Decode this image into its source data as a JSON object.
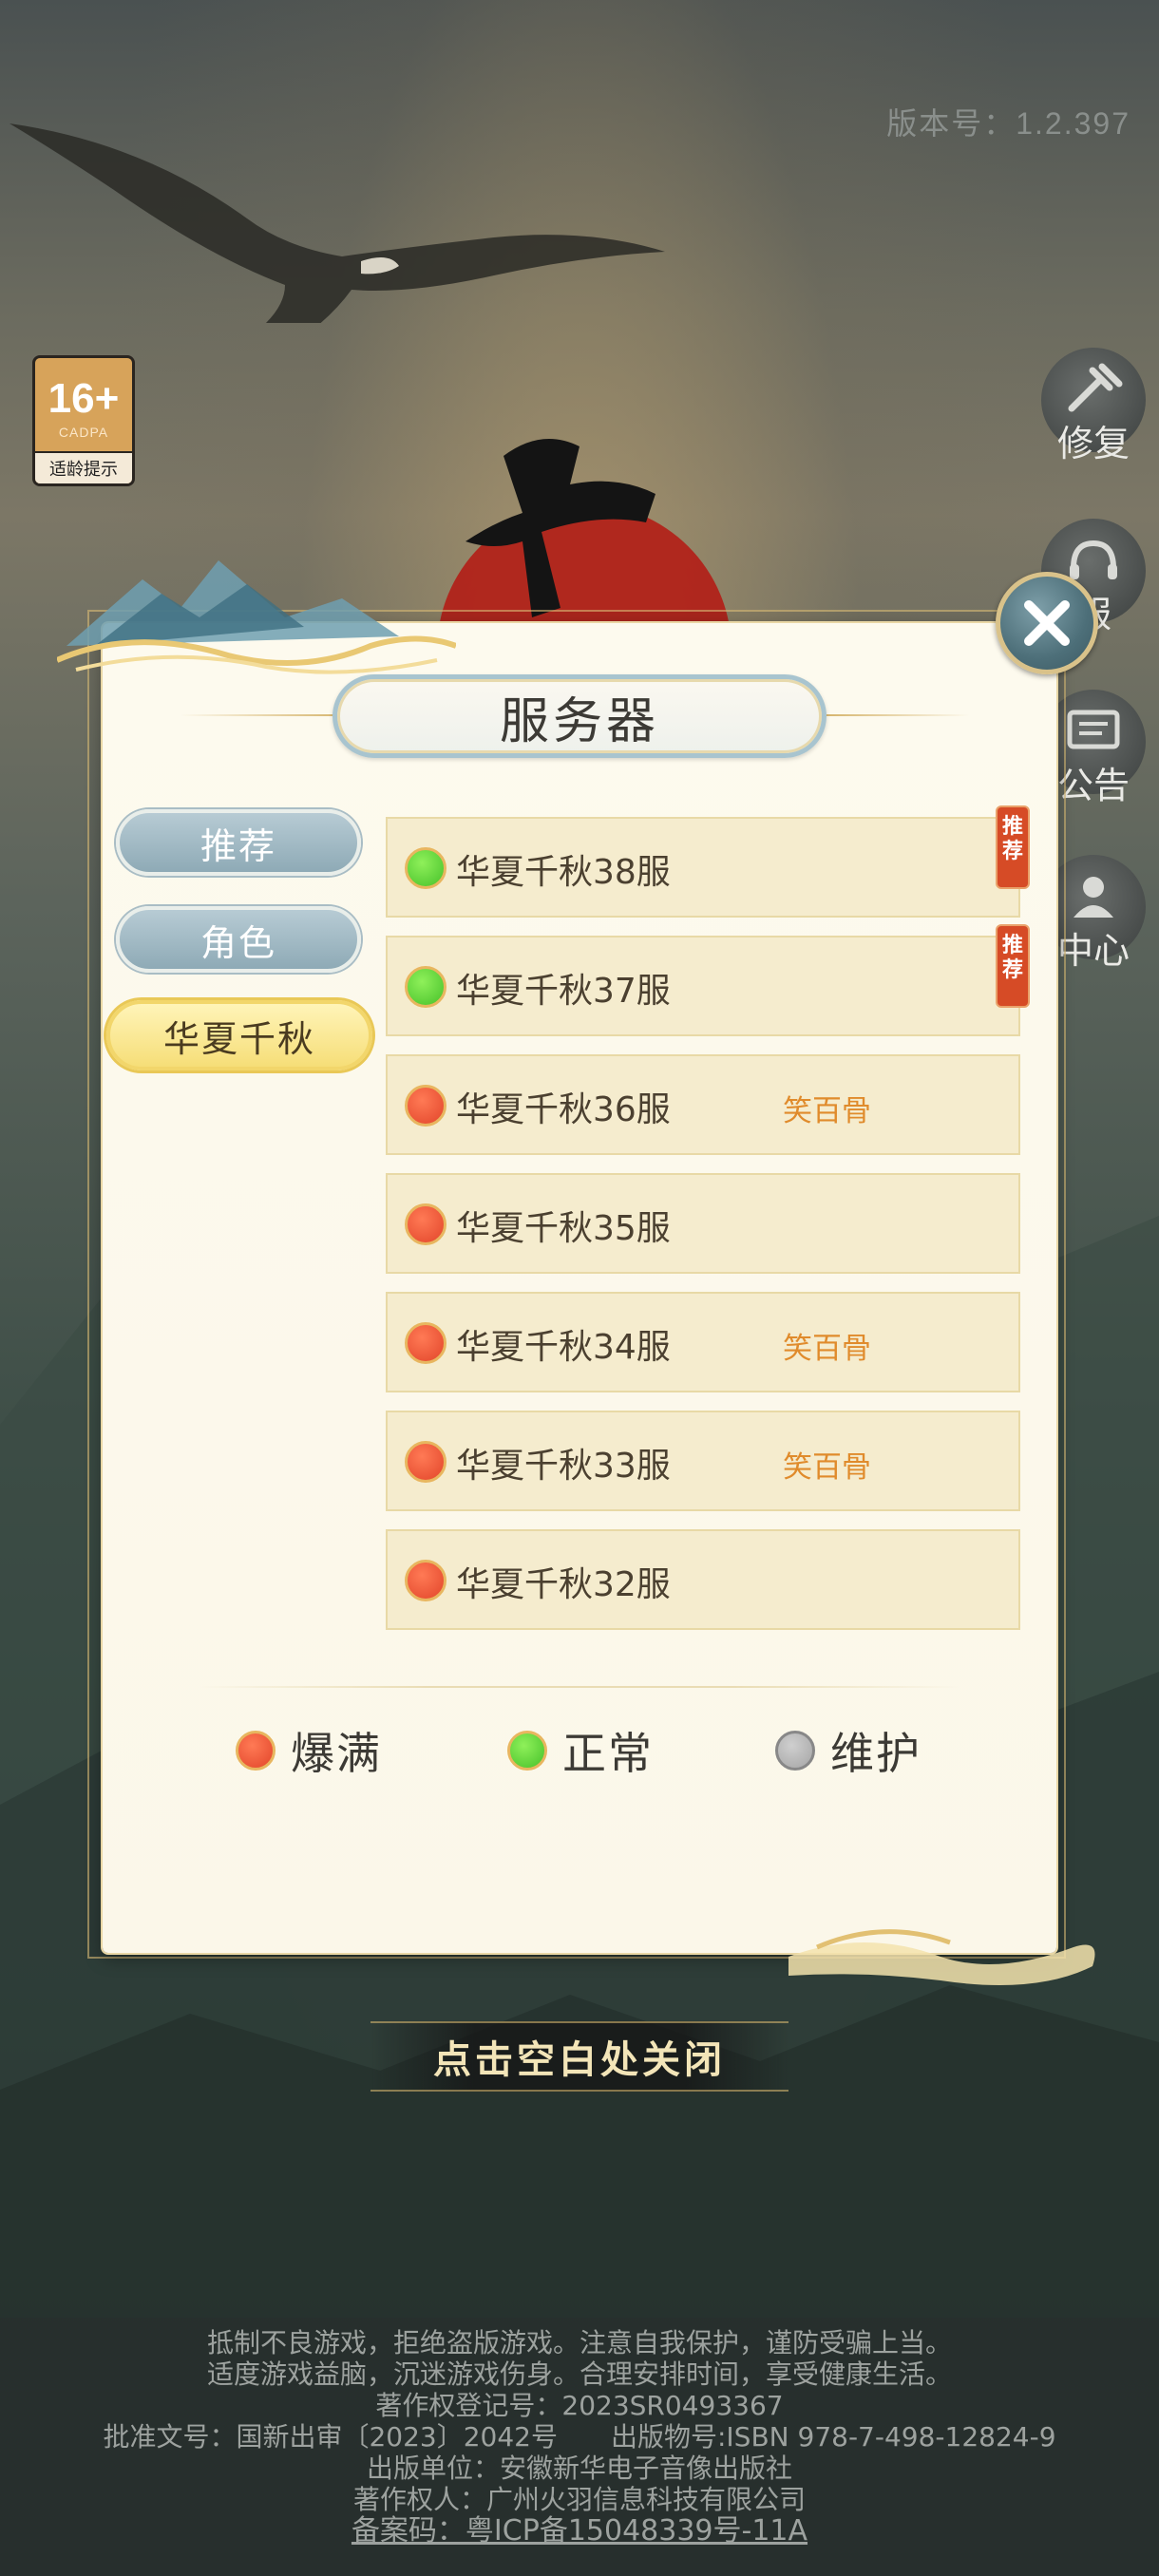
{
  "version": "版本号：1.2.397",
  "age_badge": {
    "rating": "16+",
    "org": "CADPA",
    "tip": "适龄提示"
  },
  "side_buttons": [
    {
      "label": "修复",
      "icon": "wrench-hammer-icon"
    },
    {
      "label": "服",
      "icon": "headset-icon"
    },
    {
      "label": "公告",
      "icon": "notice-board-icon"
    },
    {
      "label": "中心",
      "icon": "user-center-icon"
    }
  ],
  "dialog": {
    "title": "服务器",
    "tabs": [
      {
        "label": "推荐",
        "active": false
      },
      {
        "label": "角色",
        "active": false
      },
      {
        "label": "华夏千秋",
        "active": true
      }
    ],
    "servers": [
      {
        "name": "华夏千秋38服",
        "status": "green",
        "tag": "",
        "recommended": true
      },
      {
        "name": "华夏千秋37服",
        "status": "green",
        "tag": "",
        "recommended": true
      },
      {
        "name": "华夏千秋36服",
        "status": "red",
        "tag": "笑百骨",
        "recommended": false
      },
      {
        "name": "华夏千秋35服",
        "status": "red",
        "tag": "",
        "recommended": false
      },
      {
        "name": "华夏千秋34服",
        "status": "red",
        "tag": "笑百骨",
        "recommended": false
      },
      {
        "name": "华夏千秋33服",
        "status": "red",
        "tag": "笑百骨",
        "recommended": false
      },
      {
        "name": "华夏千秋32服",
        "status": "red",
        "tag": "",
        "recommended": false
      }
    ],
    "recommend_badge": "推荐",
    "legend": [
      {
        "label": "爆满",
        "color": "red"
      },
      {
        "label": "正常",
        "color": "green"
      },
      {
        "label": "维护",
        "color": "grey"
      }
    ]
  },
  "close_hint": "点击空白处关闭",
  "footer": {
    "lines": [
      "抵制不良游戏，拒绝盗版游戏。注意自我保护，谨防受骗上当。",
      "适度游戏益脑，沉迷游戏伤身。合理安排时间，享受健康生活。",
      "著作权登记号：2023SR0493367",
      "批准文号：国新出审〔2023〕2042号　　出版物号:ISBN 978-7-498-12824-9",
      "出版单位：安徽新华电子音像出版社",
      "著作权人：广州火羽信息科技有限公司"
    ],
    "icp": "备案码：粤ICP备15048339号-11A"
  },
  "colors": {
    "status_red": "#e2452a",
    "status_green": "#46c12a",
    "status_grey": "#a5a5a5",
    "tag_orange": "#e08b2c",
    "active_tab": "#f6de78",
    "inactive_tab": "#8eaab6"
  }
}
